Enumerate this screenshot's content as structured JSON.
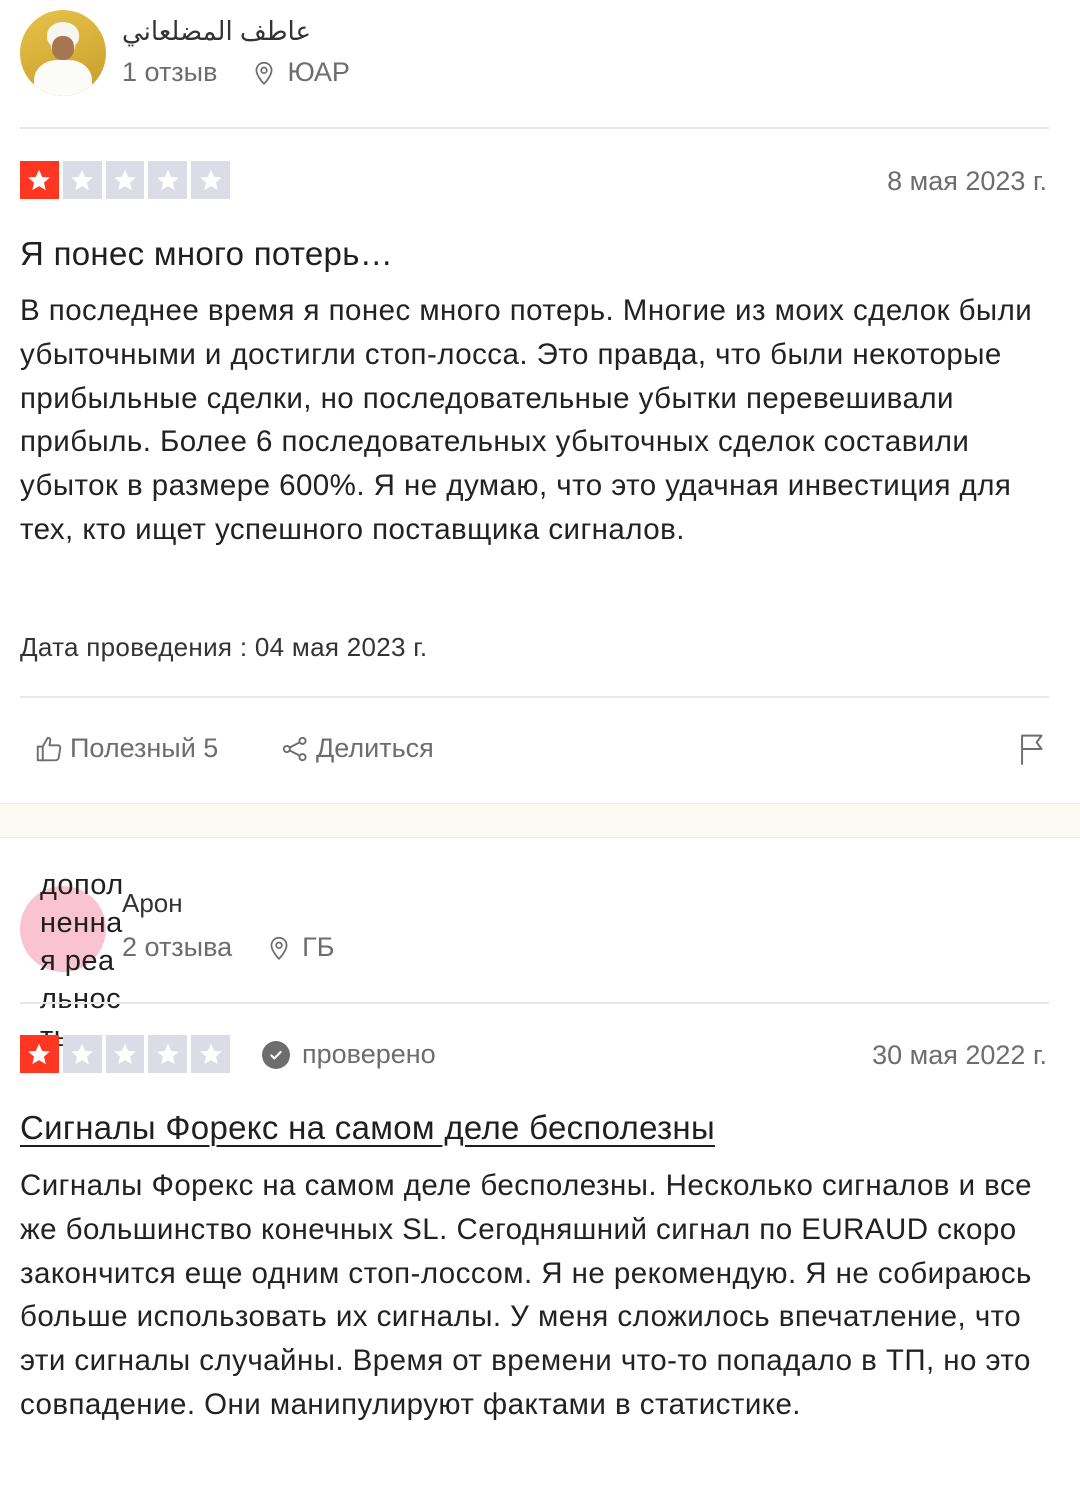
{
  "review1": {
    "reviewer_name": "عاطف المضلعاني",
    "reviews_count": "1 отзыв",
    "country": "ЮАР",
    "rating": 1,
    "date": "8 мая 2023 г.",
    "title": "Я понес много потерь…",
    "body": "В последнее время я понес много потерь. Многие из моих сделок были убыточными и достигли стоп-лосса. Это правда, что были некоторые прибыльные сделки, но последовательные убытки перевешивали прибыль. Более 6 последовательных убыточных сделок составили убыток в размере 600%. Я не думаю, что это удачная инвестиция для тех, кто ищет успешного поставщика сигналов.",
    "experience_date": "Дата проведения : 04 мая 2023 г.",
    "useful_label": "Полезный 5",
    "share_label": "Делиться"
  },
  "review2": {
    "avatar_alt": "дополненная реальность",
    "reviewer_name": "Арон",
    "reviews_count": "2 отзыва",
    "country": "ГБ",
    "rating": 1,
    "verified_label": "проверено",
    "date": "30 мая 2022 г.",
    "title": "Сигналы Форекс на самом деле бесполезны",
    "body": "Сигналы Форекс на самом деле бесполезны. Несколько сигналов и все же большинство конечных SL. Сегодняшний сигнал по EURAUD скоро закончится еще одним стоп-лоссом. Я не рекомендую. Я не собираюсь больше использовать их сигналы. У меня сложилось впечатление, что эти сигналы случайны. Время от времени что-то попадало в ТП, но это совпадение. Они манипулируют фактами в статистике."
  },
  "colors": {
    "star_on": "#ff3722",
    "star_off": "#dcdce6",
    "muted_text": "#6d6d6d",
    "separator_bg": "#fcfbf3"
  },
  "icons": [
    "location-pin-icon",
    "star-icon",
    "thumbs-up-icon",
    "share-icon",
    "flag-icon",
    "verified-check-icon"
  ]
}
